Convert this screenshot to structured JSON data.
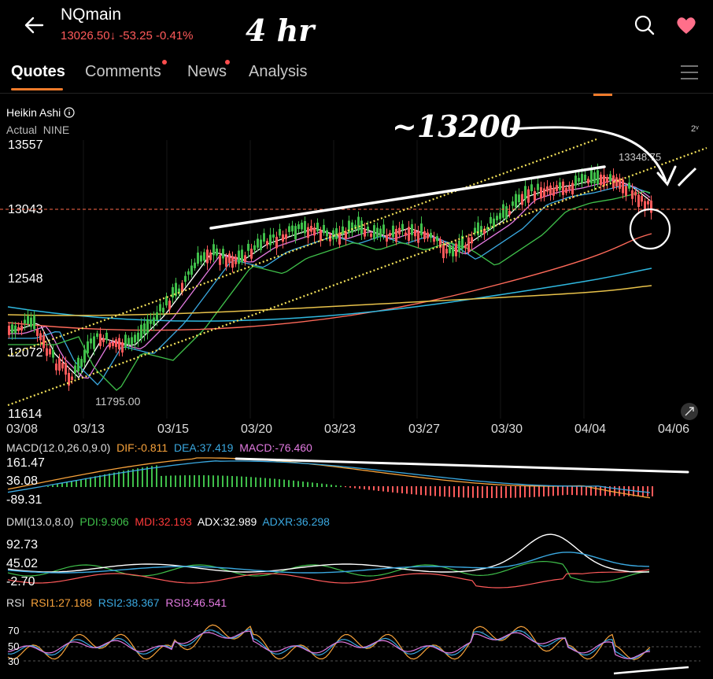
{
  "header": {
    "symbol": "NQmain",
    "price": "13026.50",
    "change": "-53.25",
    "change_pct": "-0.41%",
    "timeframe_note": "4 hr",
    "price_color": "#ff5a5a"
  },
  "tabs": [
    {
      "label": "Quotes",
      "active": true
    },
    {
      "label": "Comments",
      "has_dot": true
    },
    {
      "label": "News",
      "has_dot": true
    },
    {
      "label": "Analysis"
    }
  ],
  "chart": {
    "type_label": "Heikin Ashi",
    "sub_label_1": "Actual",
    "sub_label_2": "NINE",
    "annotation": "~13200",
    "high_label": "13348.75",
    "low_label": "11795.00",
    "y_ticks": [
      "13557",
      "13043",
      "12548",
      "12072",
      "11614"
    ],
    "dates": [
      "03/08",
      "03/13",
      "03/15",
      "03/20",
      "03/23",
      "03/27",
      "03/30",
      "04/04",
      "04/06"
    ],
    "scale_tag": "2ᵛ"
  },
  "macd": {
    "title": "MACD(12.0,26.0,9.0)",
    "dif": "DIF:-0.811",
    "dea": "DEA:37.419",
    "macd": "MACD:-76.460",
    "ticks": [
      "161.47",
      "36.08",
      "-89.31"
    ]
  },
  "dmi": {
    "title": "DMI(13.0,8.0)",
    "pdi": "PDI:9.906",
    "mdi": "MDI:32.193",
    "adx": "ADX:32.989",
    "adxr": "ADXR:36.298",
    "ticks": [
      "92.73",
      "45.02",
      "-2.70"
    ]
  },
  "rsi": {
    "title": "RSI",
    "rsi1": "RSI1:27.188",
    "rsi2": "RSI2:38.367",
    "rsi3": "RSI3:46.541",
    "ticks": [
      "70",
      "50",
      "30"
    ]
  },
  "colors": {
    "up": "#3fbf4a",
    "down": "#ff5a5a",
    "channel": "#f5e35a",
    "dif": "#f7a23b",
    "dea": "#3aa8e0",
    "rsi1": "#f7a23b",
    "rsi2": "#3aa8e0",
    "rsi3": "#e27ae0"
  },
  "icons": [
    "back-arrow-icon",
    "search-icon",
    "heart-icon",
    "menu-icon",
    "expand-icon",
    "info-icon"
  ]
}
